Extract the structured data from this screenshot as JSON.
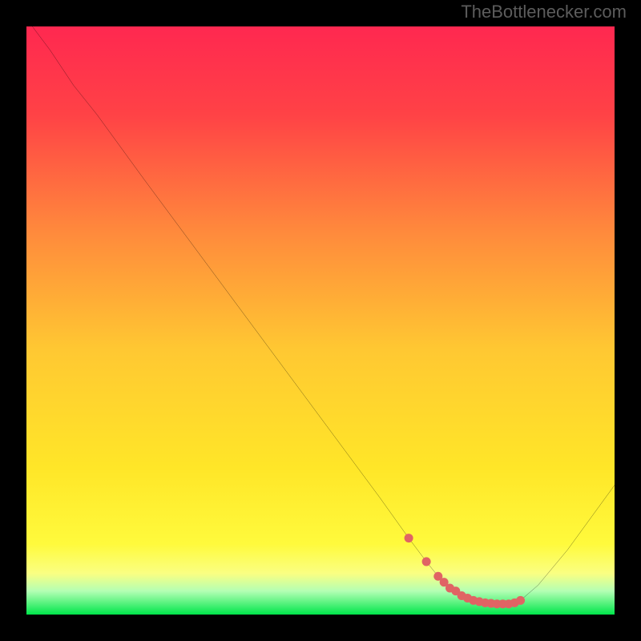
{
  "watermark": "TheBottlenecker.com",
  "chart_data": {
    "type": "line",
    "title": "",
    "xlabel": "",
    "ylabel": "",
    "xlim": [
      0,
      100
    ],
    "ylim": [
      0,
      100
    ],
    "background_gradient": {
      "stops": [
        {
          "offset": 0.0,
          "color": "#ff2850"
        },
        {
          "offset": 0.15,
          "color": "#ff4246"
        },
        {
          "offset": 0.35,
          "color": "#ff8a3c"
        },
        {
          "offset": 0.55,
          "color": "#ffc832"
        },
        {
          "offset": 0.75,
          "color": "#ffe628"
        },
        {
          "offset": 0.88,
          "color": "#fffa3c"
        },
        {
          "offset": 0.93,
          "color": "#faff82"
        },
        {
          "offset": 0.96,
          "color": "#b4ffb4"
        },
        {
          "offset": 1.0,
          "color": "#00e64b"
        }
      ]
    },
    "series": [
      {
        "name": "bottleneck-curve",
        "color": "#000000",
        "stroke_width": 2,
        "x": [
          1,
          4,
          8,
          12,
          20,
          30,
          40,
          50,
          60,
          65,
          68,
          70,
          73,
          77,
          80,
          82,
          84,
          87,
          92,
          100
        ],
        "y": [
          100,
          96,
          90,
          85,
          74,
          60.5,
          47,
          33.5,
          20,
          13,
          9,
          6.5,
          4,
          2.2,
          1.8,
          1.8,
          2.4,
          5,
          11,
          22
        ]
      },
      {
        "name": "optimal-zone-markers",
        "color": "#e06464",
        "type": "scatter",
        "marker_radius": 5,
        "x": [
          65,
          68,
          70,
          71,
          72,
          73,
          74,
          75,
          76,
          77,
          78,
          79,
          80,
          81,
          82,
          83,
          84
        ],
        "y": [
          13,
          9,
          6.5,
          5.5,
          4.5,
          4,
          3.2,
          2.8,
          2.4,
          2.2,
          2.0,
          1.9,
          1.8,
          1.8,
          1.8,
          2.0,
          2.4
        ]
      }
    ]
  }
}
